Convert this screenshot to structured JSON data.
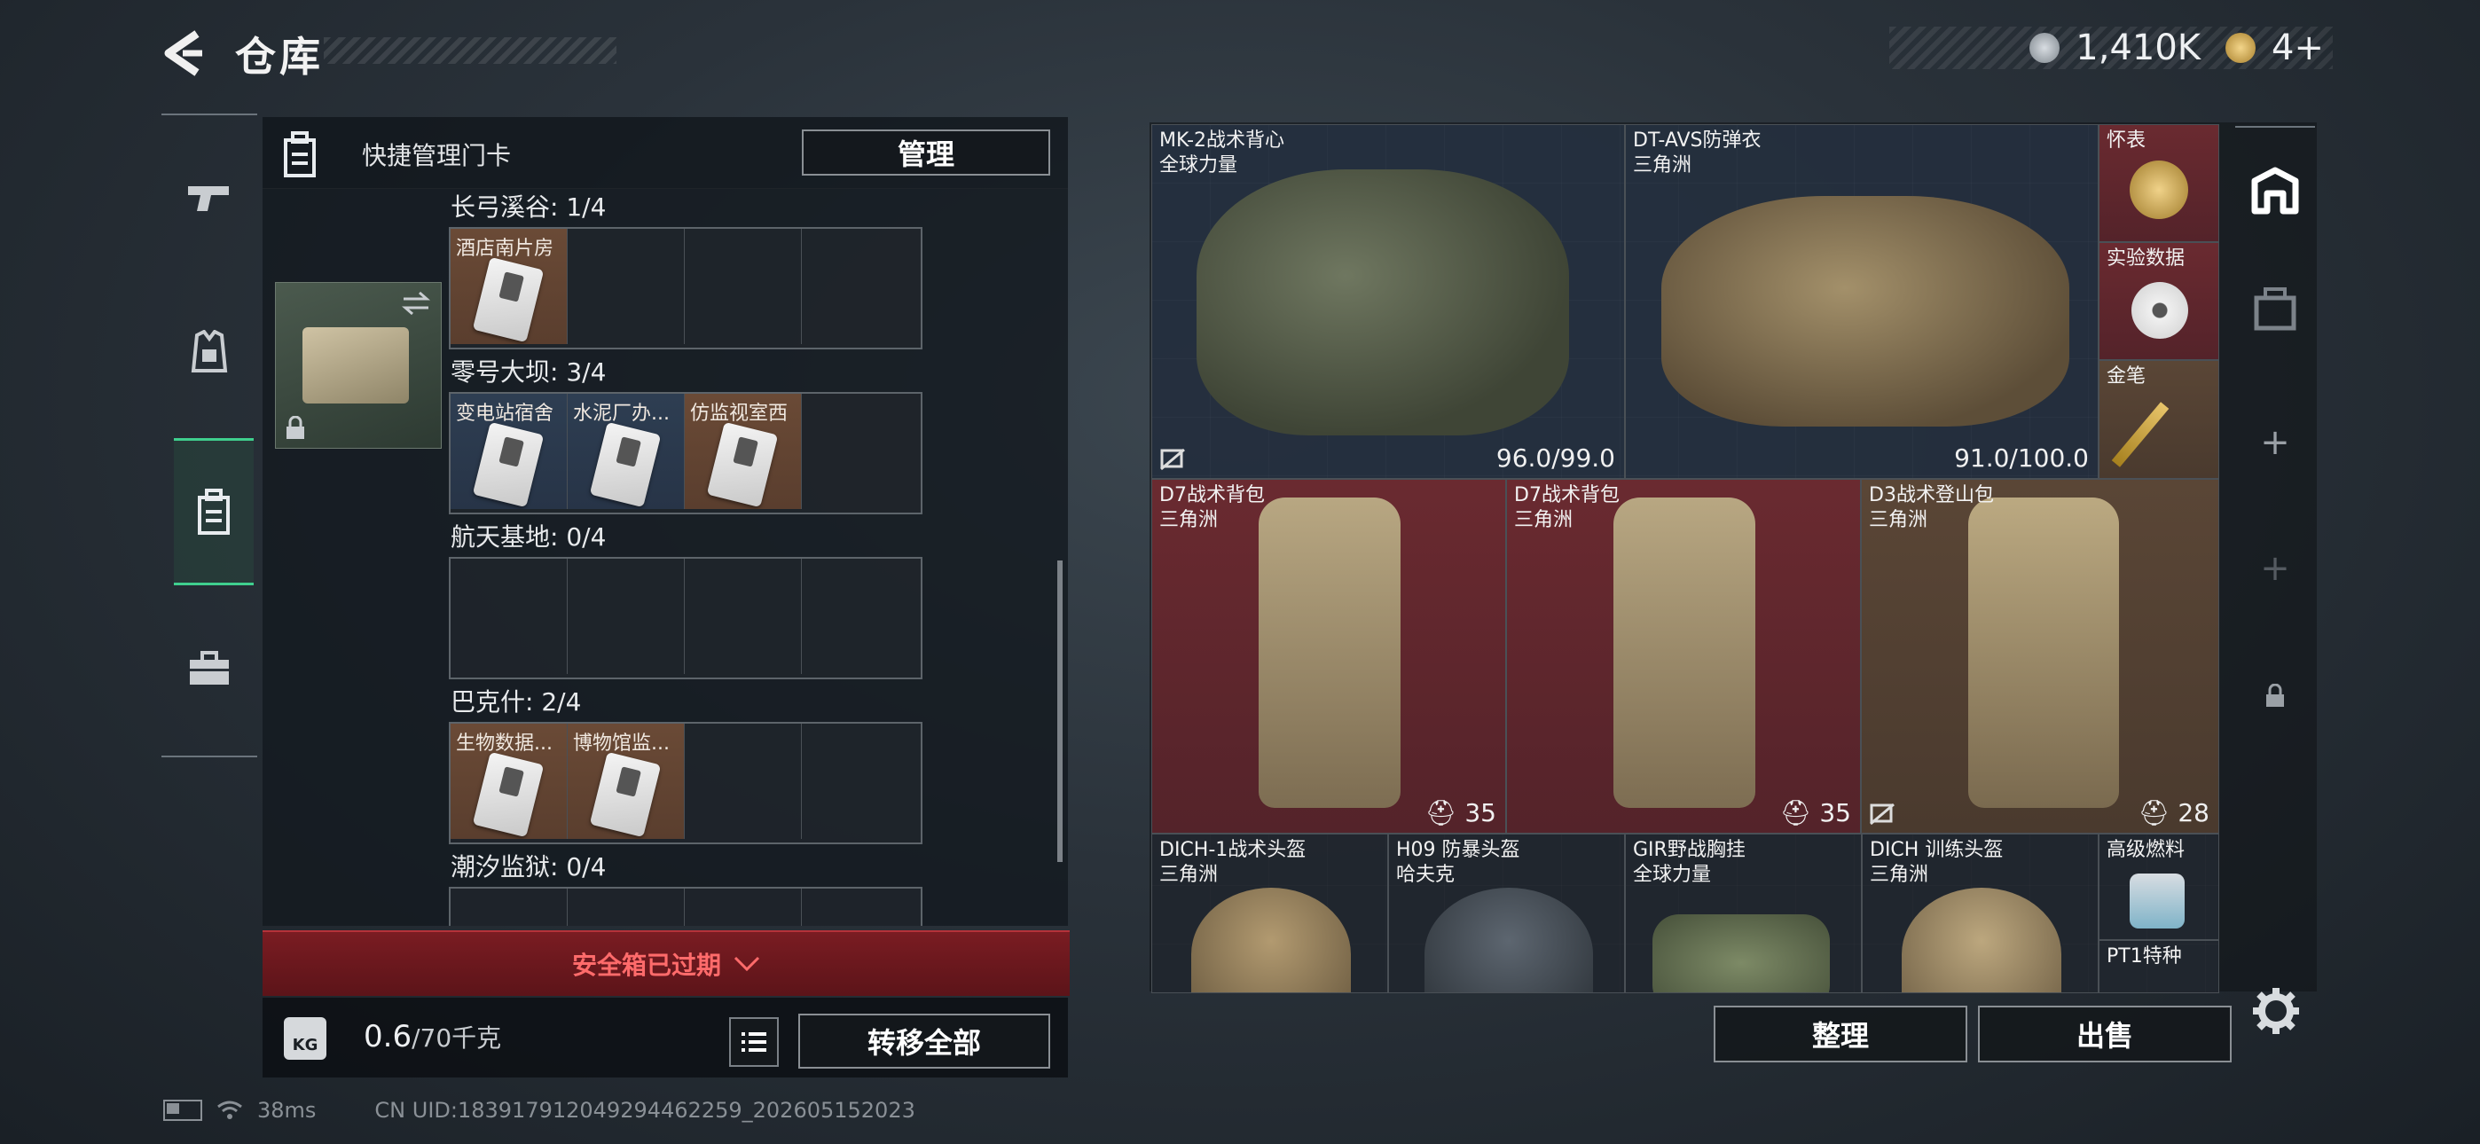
{
  "header": {
    "title": "仓库",
    "currency1": "1,410K",
    "currency2": "4+"
  },
  "leftnav": {
    "items": [
      "pistol-icon",
      "armor-icon",
      "keycard-case-icon",
      "toolbox-icon"
    ]
  },
  "leftpanel": {
    "title": "快捷管理门卡",
    "manage_label": "管理",
    "sections": [
      {
        "label": "长弓溪谷: 1/4",
        "cells": [
          {
            "label": "酒店南片房",
            "tone": "brown"
          }
        ]
      },
      {
        "label": "零号大坝: 3/4",
        "cells": [
          {
            "label": "变电站宿舍",
            "tone": "blue"
          },
          {
            "label": "水泥厂办...",
            "tone": "blue"
          },
          {
            "label": "仿监视室西",
            "tone": "brown"
          }
        ]
      },
      {
        "label": "航天基地: 0/4",
        "cells": []
      },
      {
        "label": "巴克什: 2/4",
        "cells": [
          {
            "label": "生物数据...",
            "tone": "brown"
          },
          {
            "label": "博物馆监...",
            "tone": "brown"
          }
        ]
      },
      {
        "label": "潮汐监狱: 0/4",
        "cells": []
      }
    ],
    "expired_label": "安全箱已过期",
    "weight_value": "0.6",
    "weight_unit": "/70千克",
    "transfer_label": "转移全部"
  },
  "stash": {
    "items": [
      {
        "name": "MK-2战术背心",
        "brand": "全球力量",
        "value": "96.0/99.0"
      },
      {
        "name": "DT-AVS防弹衣",
        "brand": "三角洲",
        "value": "91.0/100.0"
      },
      {
        "name": "怀表",
        "brand": "",
        "value": ""
      },
      {
        "name": "实验数据",
        "brand": "",
        "value": ""
      },
      {
        "name": "金笔",
        "brand": "",
        "value": ""
      },
      {
        "name": "D7战术背包",
        "brand": "三角洲",
        "value": "35"
      },
      {
        "name": "D7战术背包",
        "brand": "三角洲",
        "value": "35"
      },
      {
        "name": "D3战术登山包",
        "brand": "三角洲",
        "value": "28"
      },
      {
        "name": "DICH-1战术头盔",
        "brand": "三角洲",
        "value": ""
      },
      {
        "name": "H09 防暴头盔",
        "brand": "哈夫克",
        "value": ""
      },
      {
        "name": "GIR野战胸挂",
        "brand": "全球力量",
        "value": ""
      },
      {
        "name": "DICH 训练头盔",
        "brand": "三角洲",
        "value": ""
      },
      {
        "name": "高级燃料",
        "brand": "",
        "value": ""
      },
      {
        "name": "PT1特种",
        "brand": "",
        "value": ""
      }
    ],
    "sort_label": "整理",
    "sell_label": "出售"
  },
  "status": {
    "ping": "38ms",
    "uid": "CN UID:18391791204929446225​9_202605152023"
  }
}
